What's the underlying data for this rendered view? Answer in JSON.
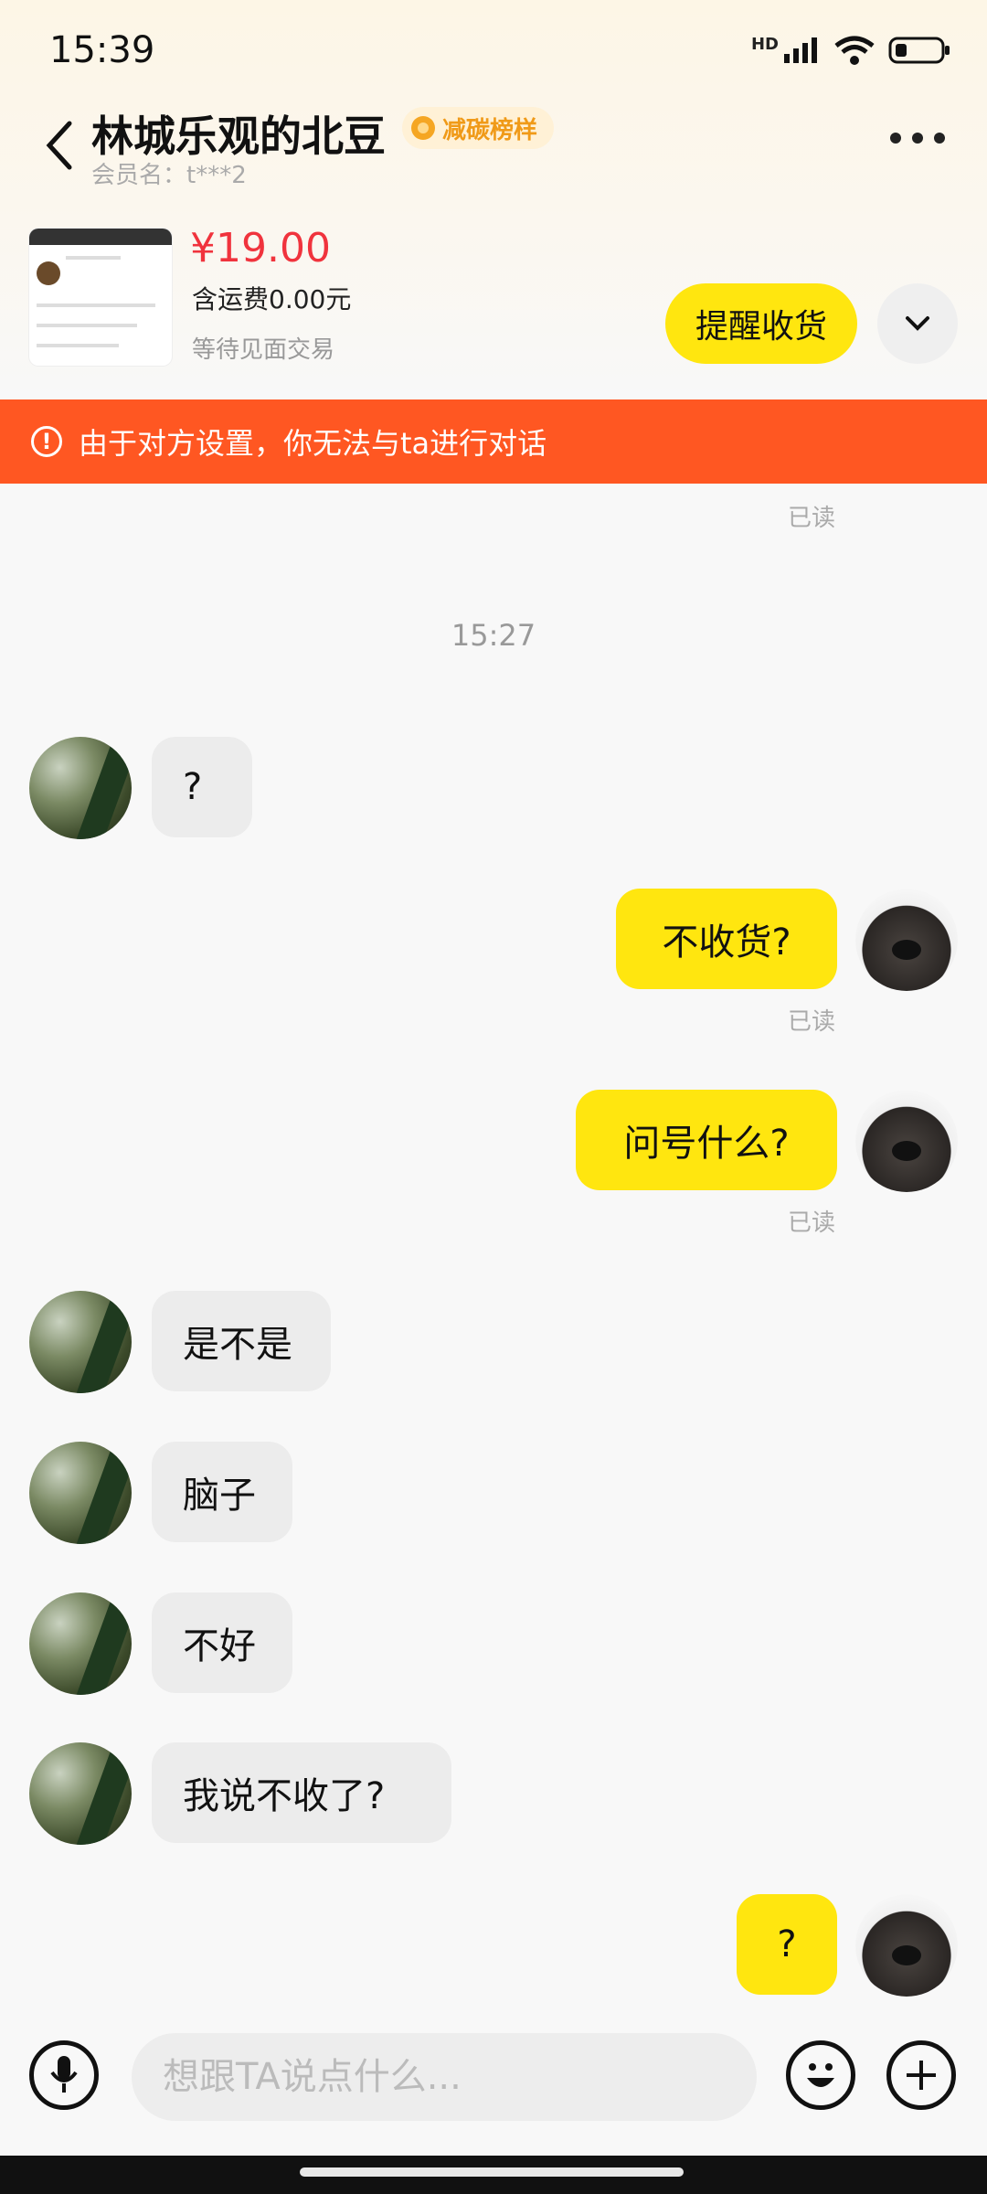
{
  "status_bar": {
    "time": "15:39",
    "network": "HD"
  },
  "header": {
    "title": "林城乐观的北豆",
    "badge": "减碳榜样",
    "member": "会员名：t***2"
  },
  "product": {
    "price": "¥19.00",
    "shipping": "含运费0.00元",
    "status": "等待见面交易",
    "remind_button": "提醒收货"
  },
  "banner": {
    "text": "由于对方设置，你无法与ta进行对话"
  },
  "chat": {
    "read_label": "已读",
    "timestamp": "15:27",
    "messages": [
      {
        "side": "in",
        "text": "?"
      },
      {
        "side": "out",
        "text": "不收货?"
      },
      {
        "side": "out",
        "text": "问号什么?"
      },
      {
        "side": "in",
        "text": "是不是"
      },
      {
        "side": "in",
        "text": "脑子"
      },
      {
        "side": "in",
        "text": "不好"
      },
      {
        "side": "in",
        "text": "我说不收了?"
      },
      {
        "side": "out",
        "text": "?"
      }
    ]
  },
  "input": {
    "placeholder": "想跟TA说点什么..."
  },
  "colors": {
    "accent": "#ffe60f",
    "banner": "#ff5722",
    "price": "#f0333d",
    "badge": "#f09a18"
  },
  "icons": [
    "back-icon",
    "more-icon",
    "chevron-down-icon",
    "alert-icon",
    "mic-icon",
    "emoji-icon",
    "plus-icon",
    "signal-icon",
    "wifi-icon",
    "battery-icon"
  ]
}
